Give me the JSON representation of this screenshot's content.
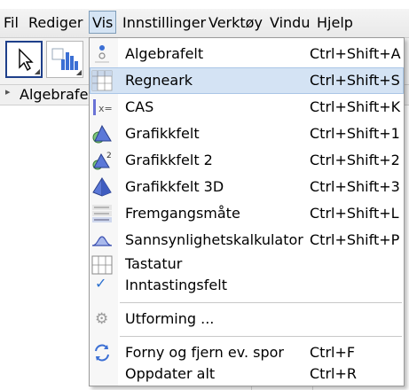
{
  "menubar": {
    "items": [
      "Fil",
      "Rediger",
      "Vis",
      "Innstillinger",
      "Verktøy",
      "Vindu",
      "Hjelp"
    ],
    "active": "Vis"
  },
  "panel": {
    "title": "Algebrafe"
  },
  "menu": {
    "items": [
      {
        "label": "Algebrafelt",
        "shortcut": "Ctrl+Shift+A",
        "icon": "algebra-view-icon"
      },
      {
        "label": "Regneark",
        "shortcut": "Ctrl+Shift+S",
        "icon": "spreadsheet-icon",
        "highlighted": true
      },
      {
        "label": "CAS",
        "shortcut": "Ctrl+Shift+K",
        "icon": "cas-icon"
      },
      {
        "label": "Grafikkfelt",
        "shortcut": "Ctrl+Shift+1",
        "icon": "graphics-icon"
      },
      {
        "label": "Grafikkfelt 2",
        "shortcut": "Ctrl+Shift+2",
        "icon": "graphics2-icon"
      },
      {
        "label": "Grafikkfelt 3D",
        "shortcut": "Ctrl+Shift+3",
        "icon": "graphics3d-icon"
      },
      {
        "label": "Fremgangsmåte",
        "shortcut": "Ctrl+Shift+L",
        "icon": "construction-protocol-icon"
      },
      {
        "label": "Sannsynlighetskalkulator",
        "shortcut": "Ctrl+Shift+P",
        "icon": "probability-icon"
      },
      {
        "label": "Tastatur",
        "shortcut": "",
        "icon": "keyboard-icon"
      },
      {
        "label": "Inntastingsfelt",
        "shortcut": "",
        "icon": "checkmark-icon",
        "checked": true
      },
      {
        "label": "Utforming ...",
        "shortcut": "",
        "icon": "gear-icon"
      },
      {
        "label": "Forny og fjern ev. spor",
        "shortcut": "Ctrl+F",
        "icon": "refresh-icon"
      },
      {
        "label": "Oppdater alt",
        "shortcut": "Ctrl+R",
        "icon": ""
      }
    ]
  },
  "colors": {
    "highlight": "#d4e3f4",
    "accent": "#2a6fcf",
    "menu_border": "#9a9a9a"
  }
}
